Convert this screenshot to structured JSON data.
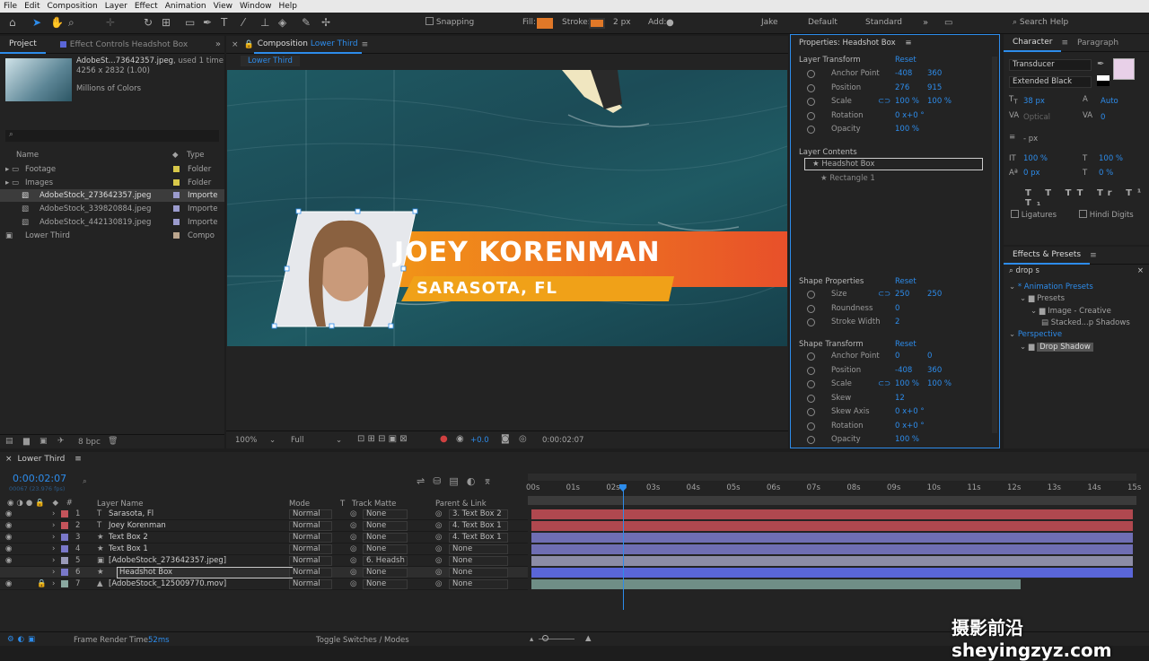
{
  "menu": [
    "File",
    "Edit",
    "Composition",
    "Layer",
    "Effect",
    "Animation",
    "View",
    "Window",
    "Help"
  ],
  "toolbar": {
    "snapping": "Snapping",
    "fill": "Fill:",
    "stroke": "Stroke:",
    "stroke_px": "2 px",
    "add": "Add:",
    "user": "Jake",
    "ws1": "Default",
    "ws2": "Standard",
    "search": "Search Help"
  },
  "project": {
    "tab": "Project",
    "tab2": "Effect Controls Headshot Box",
    "file": "AdobeSt...73642357.jpeg",
    "used": ", used 1 time",
    "dims": "4256 x 2832 (1.00)",
    "colors": "Millions of Colors",
    "col_name": "Name",
    "col_type": "Type",
    "items": [
      {
        "name": "Footage",
        "type": "Folder",
        "indent": 0,
        "color": "#d8c84a"
      },
      {
        "name": "Images",
        "type": "Folder",
        "indent": 0,
        "color": "#d8c84a"
      },
      {
        "name": "AdobeStock_273642357.jpeg",
        "type": "Importe",
        "indent": 1,
        "color": "#9b9bcd"
      },
      {
        "name": "AdobeStock_339820884.jpeg",
        "type": "Importe",
        "indent": 1,
        "color": "#9b9bcd"
      },
      {
        "name": "AdobeStock_442130819.jpeg",
        "type": "Importe",
        "indent": 1,
        "color": "#9b9bcd"
      },
      {
        "name": "Lower Third",
        "type": "Compo",
        "indent": 0,
        "color": "#bca68e"
      }
    ],
    "bpc": "8 bpc"
  },
  "comp": {
    "tab": "Composition",
    "tab_name": "Lower Third",
    "crumb": "Lower Third",
    "zoom": "100%",
    "res": "Full",
    "time": "0:00:02:07",
    "exposure": "+0.0",
    "name_text": "JOEY KORENMAN",
    "loc_text": "SARASOTA, FL"
  },
  "props": {
    "title": "Properties: Headshot Box",
    "layer_transform": "Layer Transform",
    "reset": "Reset",
    "lt": [
      {
        "label": "Anchor Point",
        "v1": "-408",
        "v2": "360"
      },
      {
        "label": "Position",
        "v1": "276",
        "v2": "915"
      },
      {
        "label": "Scale",
        "v1": "100 %",
        "v2": "100 %"
      },
      {
        "label": "Rotation",
        "v1": "0 x+0 °",
        "v2": ""
      },
      {
        "label": "Opacity",
        "v1": "100 %",
        "v2": ""
      }
    ],
    "layer_contents": "Layer Contents",
    "content1": "Headshot Box",
    "content2": "Rectangle 1",
    "shape_props": "Shape Properties",
    "sp": [
      {
        "label": "Size",
        "v1": "250",
        "v2": "250"
      },
      {
        "label": "Roundness",
        "v1": "0",
        "v2": ""
      },
      {
        "label": "Stroke Width",
        "v1": "2",
        "v2": ""
      }
    ],
    "shape_transform": "Shape Transform",
    "st": [
      {
        "label": "Anchor Point",
        "v1": "0",
        "v2": "0"
      },
      {
        "label": "Position",
        "v1": "-408",
        "v2": "360"
      },
      {
        "label": "Scale",
        "v1": "100 %",
        "v2": "100 %"
      },
      {
        "label": "Skew",
        "v1": "12",
        "v2": ""
      },
      {
        "label": "Skew Axis",
        "v1": "0 x+0 °",
        "v2": ""
      },
      {
        "label": "Rotation",
        "v1": "0 x+0 °",
        "v2": ""
      },
      {
        "label": "Opacity",
        "v1": "100 %",
        "v2": ""
      }
    ]
  },
  "character": {
    "tab": "Character",
    "tab2": "Paragraph",
    "font": "Transducer",
    "style": "Extended Black",
    "size": "38 px",
    "leading": "Auto",
    "kerning": "Optical",
    "tracking": "0",
    "stroke": "- px",
    "vscale": "100 %",
    "hscale": "100 %",
    "baseline": "0 px",
    "tsume": "0 %",
    "ligatures": "Ligatures",
    "hindi": "Hindi Digits"
  },
  "effects": {
    "tab": "Effects & Presets",
    "search": "drop s",
    "tree": [
      {
        "t": "* Animation Presets",
        "lvl": 0
      },
      {
        "t": "Presets",
        "lvl": 1
      },
      {
        "t": "Image - Creative",
        "lvl": 2
      },
      {
        "t": "Stacked...p Shadows",
        "lvl": 3
      },
      {
        "t": "Perspective",
        "lvl": 0
      },
      {
        "t": "Drop Shadow",
        "lvl": 1
      }
    ]
  },
  "timeline": {
    "tab": "Lower Third",
    "time": "0:00:02:07",
    "frames": "00067 (23.976 fps)",
    "col_layer": "Layer Name",
    "col_mode": "Mode",
    "col_t": "T",
    "col_matte": "Track Matte",
    "col_parent": "Parent & Link",
    "ticks": [
      "00s",
      "01s",
      "02s",
      "03s",
      "04s",
      "05s",
      "06s",
      "07s",
      "08s",
      "09s",
      "10s",
      "11s",
      "12s",
      "13s",
      "14s",
      "15s"
    ],
    "playhead_sec": 2.28,
    "duration_sec": 15,
    "layers": [
      {
        "num": "1",
        "icon": "T",
        "name": "Sarasota, Fl",
        "color": "#c4545b",
        "mode": "Normal",
        "matte": "None",
        "parent": "3. Text Box 2",
        "bar": "#b0484f",
        "start": 0,
        "end": 15
      },
      {
        "num": "2",
        "icon": "T",
        "name": "Joey Korenman",
        "color": "#c4545b",
        "mode": "Normal",
        "matte": "None",
        "parent": "4. Text Box 1",
        "bar": "#b0484f",
        "start": 0,
        "end": 15
      },
      {
        "num": "3",
        "icon": "★",
        "name": "Text Box 2",
        "color": "#7a78c9",
        "mode": "Normal",
        "matte": "None",
        "parent": "4. Text Box 1",
        "bar": "#6f6eb3",
        "start": 0,
        "end": 15
      },
      {
        "num": "4",
        "icon": "★",
        "name": "Text Box 1",
        "color": "#7a78c9",
        "mode": "Normal",
        "matte": "None",
        "parent": "None",
        "bar": "#6f6eb3",
        "start": 0,
        "end": 15
      },
      {
        "num": "5",
        "icon": "▣",
        "name": "[AdobeStock_273642357.jpeg]",
        "color": "#9a9ab8",
        "mode": "Normal",
        "matte": "6. Headsh",
        "parent": "None",
        "bar": "#8c8ca6",
        "start": 0,
        "end": 15
      },
      {
        "num": "6",
        "icon": "★",
        "name": "Headshot Box",
        "color": "#7a78c9",
        "mode": "Normal",
        "matte": "None",
        "parent": "None",
        "bar": "#5a66d8",
        "start": 0,
        "end": 15
      },
      {
        "num": "7",
        "icon": "▲",
        "name": "[AdobeStock_125009770.mov]",
        "color": "#8aa8a0",
        "mode": "Normal",
        "matte": "None",
        "parent": "None",
        "bar": "#6f8e86",
        "start": 0,
        "end": 12.2
      }
    ],
    "render_label": "Frame Render Time:",
    "render_value": "52ms",
    "toggle": "Toggle Switches / Modes"
  },
  "watermark": "摄影前沿 sheyingzyz.com"
}
